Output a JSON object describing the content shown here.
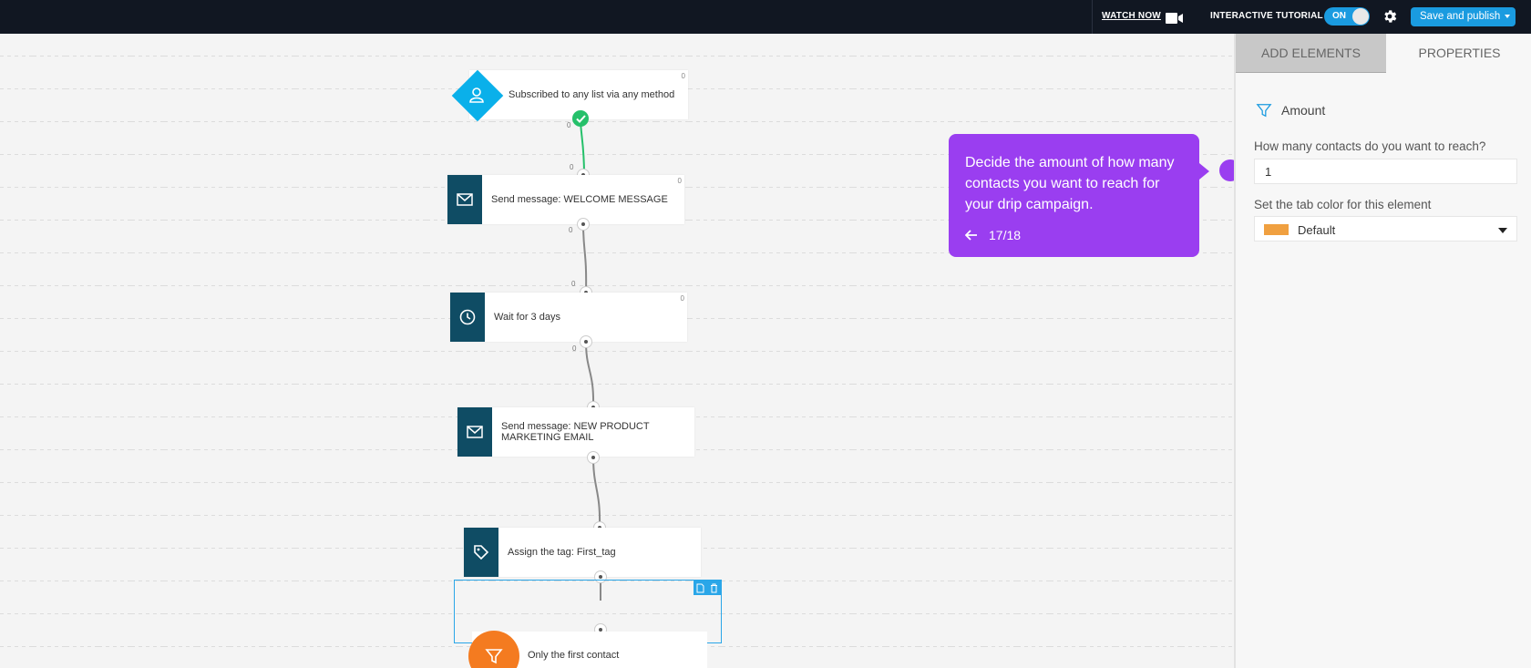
{
  "topbar": {
    "watch_now": "WATCH NOW",
    "interactive_tutorial": "INTERACTIVE TUTORIAL",
    "toggle_state": "ON",
    "publish_label": "Save and publish",
    "icons": [
      "video-camera-icon",
      "gear-icon",
      "caret-down-icon"
    ]
  },
  "flow": {
    "trigger": {
      "label": "Subscribed to any list via any method",
      "count": "0",
      "icon": "user-icon"
    },
    "steps": [
      {
        "label": "Send message: WELCOME MESSAGE",
        "count": "0",
        "icon": "envelope-icon"
      },
      {
        "label": "Wait for 3 days",
        "count": "0",
        "icon": "clock-icon"
      },
      {
        "label": "Send message: NEW PRODUCT MARKETING EMAIL",
        "count": "",
        "icon": "envelope-icon"
      },
      {
        "label": "Assign the tag: First_tag",
        "count": "",
        "icon": "tag-icon"
      }
    ],
    "filter": {
      "label": "Only the first contact",
      "icon": "funnel-icon"
    },
    "connector_counts": [
      "0",
      "0",
      "0",
      "0",
      "0",
      "0"
    ]
  },
  "tooltip": {
    "message": "Decide the amount of how many contacts you want to reach for your drip campaign.",
    "progress": "17/18",
    "back_icon": "arrow-left-icon"
  },
  "panel": {
    "tabs": [
      "ADD ELEMENTS",
      "PROPERTIES"
    ],
    "active_tab": "PROPERTIES",
    "section_title": "Amount",
    "section_icon": "funnel-icon",
    "contacts_label": "How many contacts do you want to reach?",
    "contacts_value": "1",
    "tab_color_label": "Set the tab color for this element",
    "tab_color_value": "Default",
    "tab_color_swatch": "#F0A040"
  },
  "colors": {
    "topbar": "#111722",
    "accent": "#1A9BE0",
    "node_icon_bg": "#0F4C64",
    "trigger": "#0AB0EA",
    "filter": "#F47B20",
    "tooltip": "#9A3EF0",
    "success": "#25C06A"
  }
}
